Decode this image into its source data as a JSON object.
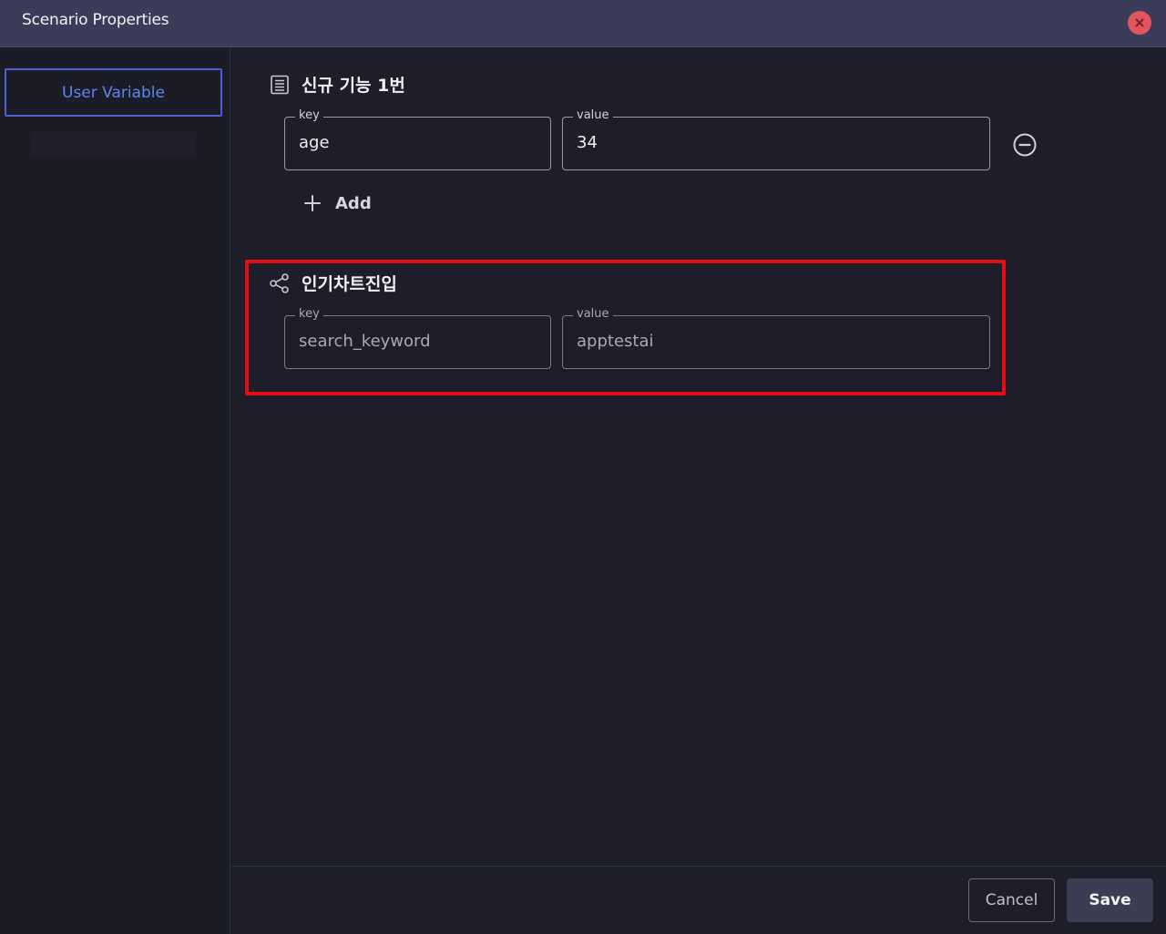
{
  "window": {
    "title": "Scenario Properties",
    "close_icon": "close-icon",
    "close_color": "#e0555f"
  },
  "sidebar": {
    "items": [
      {
        "label": "User Variable",
        "selected": true
      }
    ]
  },
  "groups": [
    {
      "title": "신규 기능 1번",
      "icon": "document-list-icon",
      "variables": [
        {
          "key_label": "key",
          "key": "age",
          "value_label": "value",
          "value": "34"
        }
      ],
      "remove_icon": "minus-circle-icon",
      "add_label": "Add",
      "add_icon": "plus-icon"
    },
    {
      "title": "인기차트진입",
      "icon": "share-icon",
      "highlighted": true,
      "highlight_color": "#e00f14",
      "variables": [
        {
          "key_label": "key",
          "key": "search_keyword",
          "value_label": "value",
          "value": "apptestai"
        }
      ]
    }
  ],
  "footer": {
    "cancel_label": "Cancel",
    "save_label": "Save"
  },
  "colors": {
    "accent": "#4a5fd6",
    "background": "#1e1e2a",
    "titlebar": "#3b3c5a"
  }
}
